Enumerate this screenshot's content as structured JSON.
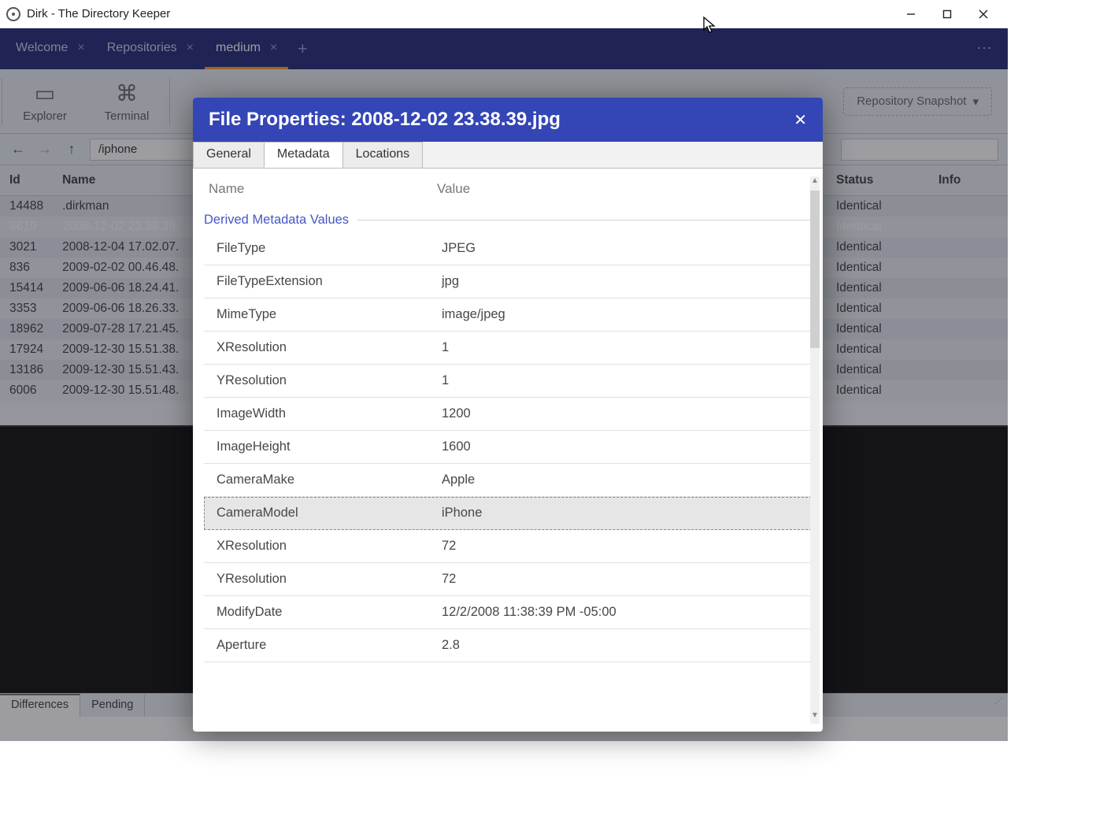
{
  "window": {
    "title": "Dirk - The Directory Keeper"
  },
  "tabs": [
    {
      "label": "Welcome",
      "active": false,
      "closable": true
    },
    {
      "label": "Repositories",
      "active": false,
      "closable": true
    },
    {
      "label": "medium",
      "active": true,
      "closable": true
    }
  ],
  "toolbar": {
    "explorer": "Explorer",
    "terminal": "Terminal",
    "snapshot": "Repository Snapshot"
  },
  "nav": {
    "path": "/iphone"
  },
  "file_table": {
    "columns": {
      "id": "Id",
      "name": "Name",
      "status": "Status",
      "info": "Info"
    },
    "rows": [
      {
        "id": "14488",
        "name": ".dirkman",
        "status": "Identical",
        "selected": false
      },
      {
        "id": "8619",
        "name": "2008-12-02 23.38.39.",
        "status": "Identical",
        "selected": true
      },
      {
        "id": "3021",
        "name": "2008-12-04 17.02.07.",
        "status": "Identical",
        "selected": false
      },
      {
        "id": "836",
        "name": "2009-02-02 00.46.48.",
        "status": "Identical",
        "selected": false
      },
      {
        "id": "15414",
        "name": "2009-06-06 18.24.41.",
        "status": "Identical",
        "selected": false
      },
      {
        "id": "3353",
        "name": "2009-06-06 18.26.33.",
        "status": "Identical",
        "selected": false
      },
      {
        "id": "18962",
        "name": "2009-07-28 17.21.45.",
        "status": "Identical",
        "selected": false
      },
      {
        "id": "17924",
        "name": "2009-12-30 15.51.38.",
        "status": "Identical",
        "selected": false
      },
      {
        "id": "13186",
        "name": "2009-12-30 15.51.43.",
        "status": "Identical",
        "selected": false
      },
      {
        "id": "6006",
        "name": "2009-12-30 15.51.48.",
        "status": "Identical",
        "selected": false
      }
    ]
  },
  "bottom_tabs": {
    "differences": "Differences",
    "pending": "Pending"
  },
  "modal": {
    "title": "File Properties: 2008-12-02 23.38.39.jpg",
    "tabs": {
      "general": "General",
      "metadata": "Metadata",
      "locations": "Locations"
    },
    "header": {
      "name": "Name",
      "value": "Value"
    },
    "section": "Derived Metadata Values",
    "rows": [
      {
        "name": "FileType",
        "value": "JPEG"
      },
      {
        "name": "FileTypeExtension",
        "value": "jpg"
      },
      {
        "name": "MimeType",
        "value": "image/jpeg"
      },
      {
        "name": "XResolution",
        "value": "1"
      },
      {
        "name": "YResolution",
        "value": "1"
      },
      {
        "name": "ImageWidth",
        "value": "1200"
      },
      {
        "name": "ImageHeight",
        "value": "1600"
      },
      {
        "name": "CameraMake",
        "value": "Apple"
      },
      {
        "name": "CameraModel",
        "value": "iPhone",
        "selected": true
      },
      {
        "name": "XResolution",
        "value": "72"
      },
      {
        "name": "YResolution",
        "value": "72"
      },
      {
        "name": "ModifyDate",
        "value": "12/2/2008 11:38:39 PM -05:00"
      },
      {
        "name": "Aperture",
        "value": "2.8"
      }
    ]
  }
}
